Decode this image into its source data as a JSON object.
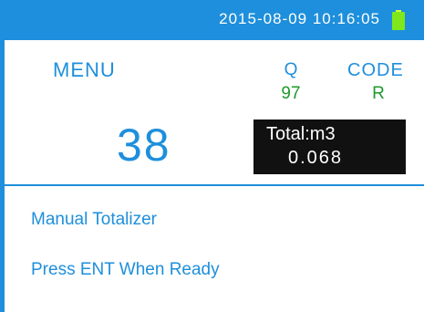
{
  "status_bar": {
    "datetime": "2015-08-09 10:16:05",
    "battery_icon": "battery-full-icon",
    "accent_color": "#1e8fdc"
  },
  "readings": {
    "menu_label": "MENU",
    "q_label": "Q",
    "q_value": "97",
    "code_label": "CODE",
    "code_value": "R",
    "main_number": "38"
  },
  "total": {
    "label": "Total:m3",
    "value": "0.068"
  },
  "messages": {
    "line1": "Manual Totalizer",
    "line2": "Press ENT When Ready"
  }
}
